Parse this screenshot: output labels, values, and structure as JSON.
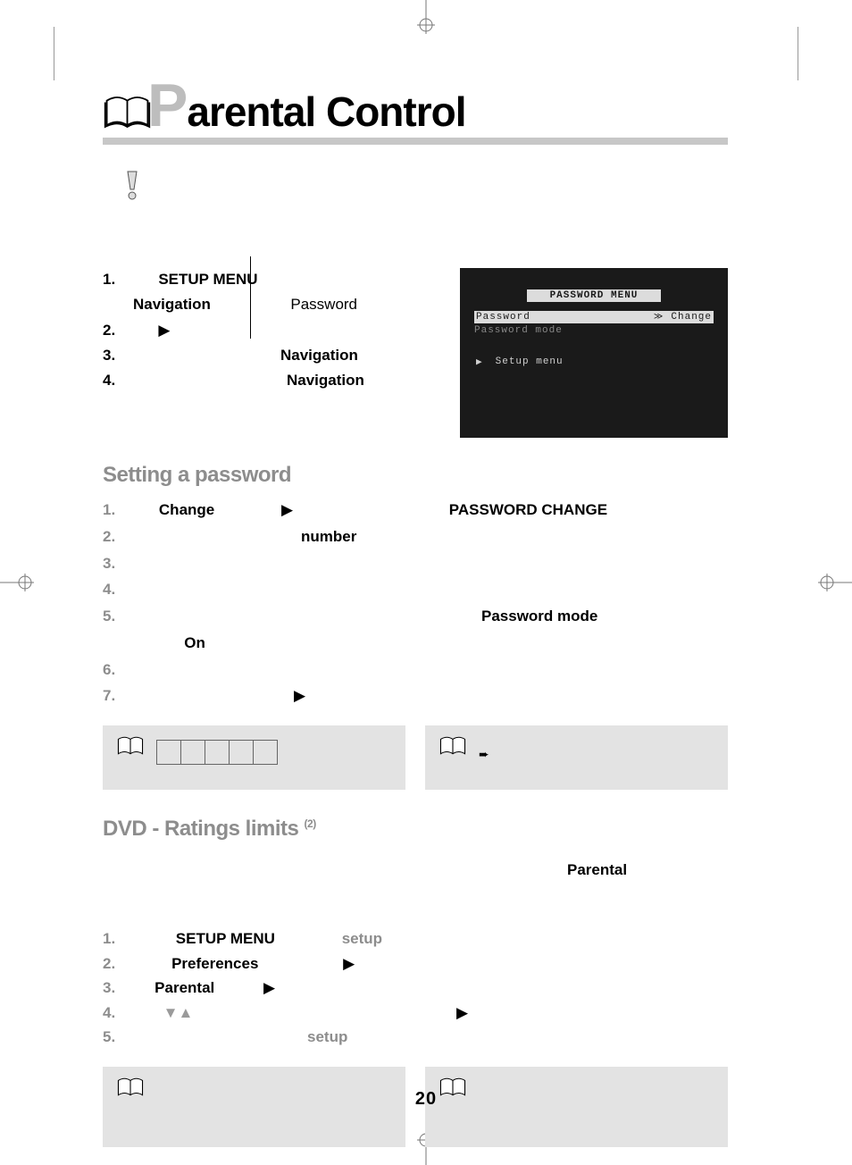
{
  "title_first": "P",
  "title_rest": "arental Control",
  "tv": {
    "menu_title": "PASSWORD  MENU",
    "row_password": "Password",
    "row_change": "Change",
    "row_mode": "Password mode",
    "bottom": "Setup  menu"
  },
  "block1": {
    "n1": "1.",
    "t1a": "SETUP  MENU",
    "t1b": "Navigation",
    "t1c": "Password",
    "n2": "2.",
    "t2_arrow": "▶",
    "n3": "3.",
    "t3": "Navigation",
    "n4": "4.",
    "t4": "Navigation"
  },
  "sub1": "Setting a password",
  "steps2": {
    "n1": "1.",
    "t1a": "Change",
    "t1b": "▶",
    "t1c": "PASSWORD  CHANGE",
    "n2": "2.",
    "t2": "number",
    "n3": "3.",
    "n4": "4.",
    "n5": "5.",
    "t5a": "Password  mode",
    "t5b": "On",
    "n6": "6.",
    "n7": "7.",
    "t7": "▶"
  },
  "note_arrow": "➨",
  "sub2": "DVD - Ratings limits ",
  "sub2_sup": "(2)",
  "parental_word": "Parental",
  "steps3": {
    "n1": "1.",
    "t1a": "SETUP MENU",
    "t1b": "setup",
    "n2": "2.",
    "t2a": "Preferences",
    "t2b": "▶",
    "n3": "3.",
    "t3a": "Parental",
    "t3b": "▶",
    "n4": "4.",
    "t4a": "▼▲",
    "t4b": "▶",
    "n5": "5.",
    "t5": "setup"
  },
  "page_number": "20"
}
